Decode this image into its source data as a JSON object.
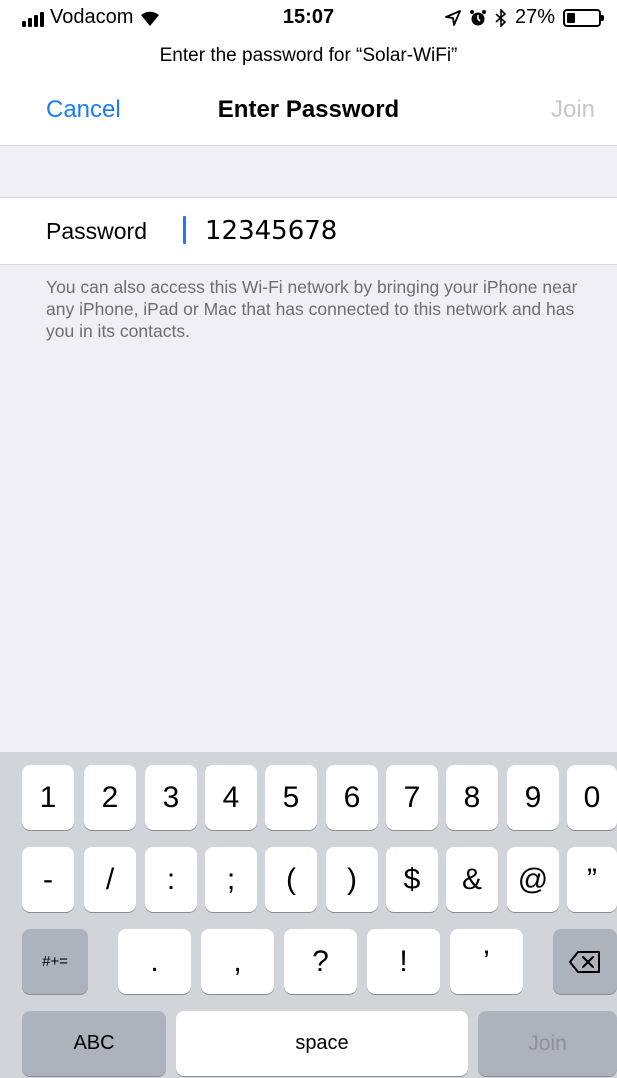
{
  "status_bar": {
    "carrier": "Vodacom",
    "time": "15:07",
    "battery_percent": "27%",
    "battery_level": 0.27,
    "icons": [
      "signal-icon",
      "wifi-icon",
      "location-icon",
      "alarm-icon",
      "bluetooth-icon",
      "battery-icon"
    ]
  },
  "prompt": "Enter the password for “Solar-WiFi”",
  "nav": {
    "cancel": "Cancel",
    "title": "Enter Password",
    "join": "Join"
  },
  "password": {
    "label": "Password",
    "value": "12345678"
  },
  "help_text": "You can also access this Wi-Fi network by bringing your iPhone near any iPhone, iPad or Mac that has connected to this network and has you in its contacts.",
  "keyboard": {
    "row1": [
      "1",
      "2",
      "3",
      "4",
      "5",
      "6",
      "7",
      "8",
      "9",
      "0"
    ],
    "row2": [
      "-",
      "/",
      ":",
      ";",
      "(",
      ")",
      "$",
      "&",
      "@",
      "”"
    ],
    "row3": [
      ".",
      ",",
      "?",
      "!",
      "’"
    ],
    "symbols_key": "#+=",
    "backspace_icon": "backspace-icon",
    "abc_key": "ABC",
    "space_key": "space",
    "join_key": "Join"
  },
  "colors": {
    "accent": "#1a7cf4",
    "disabled": "#c7c7cc",
    "background": "#efeff4",
    "keyboard": "#d1d4d9"
  }
}
